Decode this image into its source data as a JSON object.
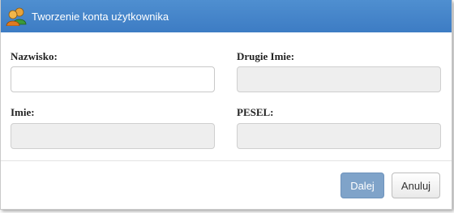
{
  "dialog": {
    "title": "Tworzenie konta użytkownika",
    "title_icon": "users-icon"
  },
  "form": {
    "nazwisko": {
      "label": "Nazwisko:",
      "value": "",
      "disabled": false
    },
    "drugie_imie": {
      "label": "Drugie Imie:",
      "value": "",
      "disabled": true
    },
    "imie": {
      "label": "Imie:",
      "value": "",
      "disabled": true
    },
    "pesel": {
      "label": "PESEL:",
      "value": "",
      "disabled": true
    }
  },
  "buttons": {
    "next_label": "Dalej",
    "cancel_label": "Anuluj"
  },
  "colors": {
    "titlebar": "#4586c9",
    "primary_button": "#7fa3c9"
  }
}
